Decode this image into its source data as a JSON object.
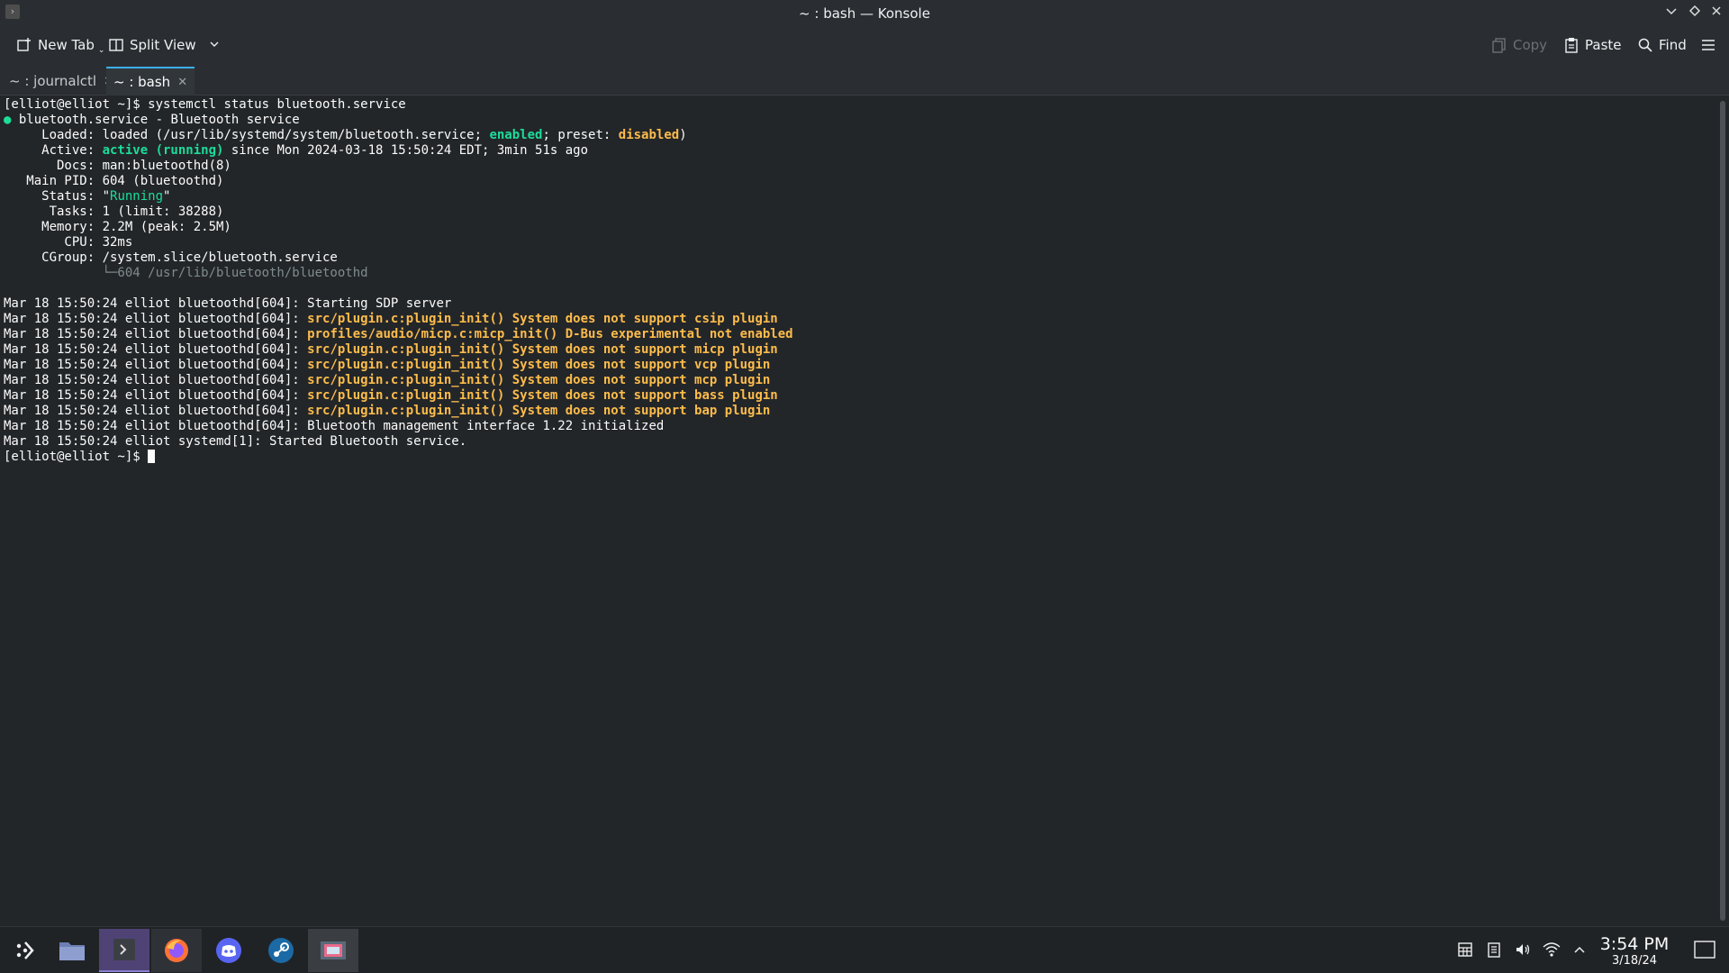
{
  "window": {
    "title": "~ : bash — Konsole"
  },
  "toolbar": {
    "new_tab": "New Tab",
    "split_view": "Split View",
    "copy": "Copy",
    "paste": "Paste",
    "find": "Find"
  },
  "tabs": [
    {
      "label": "~ : journalctl"
    },
    {
      "label": "~ : bash"
    }
  ],
  "terminal": {
    "prompt": "[elliot@elliot ~]$ ",
    "command": "systemctl status bluetooth.service",
    "header_dot": "●",
    "header": " bluetooth.service - Bluetooth service",
    "loaded_label": "     Loaded: ",
    "loaded_pre": "loaded (/usr/lib/systemd/system/bluetooth.service; ",
    "loaded_enabled": "enabled",
    "loaded_mid": "; preset: ",
    "loaded_disabled": "disabled",
    "loaded_post": ")",
    "active_label": "     Active: ",
    "active_state": "active (running)",
    "active_post": " since Mon 2024-03-18 15:50:24 EDT; 3min 51s ago",
    "docs": "       Docs: man:bluetoothd(8)",
    "mainpid": "   Main PID: 604 (bluetoothd)",
    "status_label": "     Status: ",
    "status_q1": "\"",
    "status_val": "Running",
    "status_q2": "\"",
    "tasks": "      Tasks: 1 (limit: 38288)",
    "memory": "     Memory: 2.2M (peak: 2.5M)",
    "cpu": "        CPU: 32ms",
    "cgroup": "     CGroup: /system.slice/bluetooth.service",
    "cgroup_tree": "             └─604 /usr/lib/bluetooth/bluetoothd",
    "log_prefix": "Mar 18 15:50:24 elliot bluetoothd[604]: ",
    "log1": "Starting SDP server",
    "log2": "src/plugin.c:plugin_init() System does not support csip plugin",
    "log3": "profiles/audio/micp.c:micp_init() D-Bus experimental not enabled",
    "log4": "src/plugin.c:plugin_init() System does not support micp plugin",
    "log5": "src/plugin.c:plugin_init() System does not support vcp plugin",
    "log6": "src/plugin.c:plugin_init() System does not support mcp plugin",
    "log7": "src/plugin.c:plugin_init() System does not support bass plugin",
    "log8": "src/plugin.c:plugin_init() System does not support bap plugin",
    "log9": "Bluetooth management interface 1.22 initialized",
    "log10": "Mar 18 15:50:24 elliot systemd[1]: Started Bluetooth service."
  },
  "clock": {
    "time": "3:54 PM",
    "date": "3/18/24"
  },
  "taskbar_icons": [
    "application-launcher-icon",
    "file-manager-icon",
    "konsole-icon",
    "firefox-icon",
    "discord-icon",
    "steam-icon",
    "screenshot-tool-icon"
  ],
  "tray_icons": [
    "clipboard-grid-icon",
    "notes-icon",
    "volume-icon",
    "wifi-icon",
    "chevron-up-icon",
    "show-desktop-icon"
  ]
}
